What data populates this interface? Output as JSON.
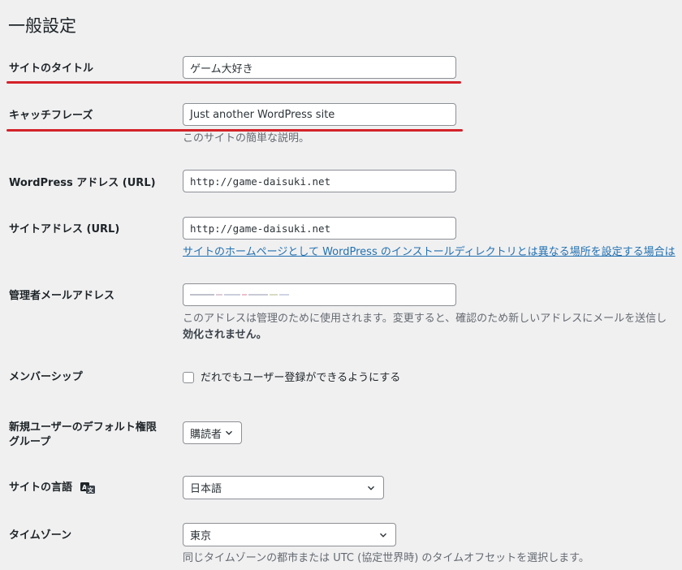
{
  "page": {
    "title": "一般設定"
  },
  "fields": {
    "site_title": {
      "label": "サイトのタイトル",
      "value": "ゲーム大好き"
    },
    "tagline": {
      "label": "キャッチフレーズ",
      "value": "Just another WordPress site",
      "description": "このサイトの簡単な説明。"
    },
    "wp_address": {
      "label": "WordPress アドレス (URL)",
      "value": "http://game-daisuki.net"
    },
    "site_address": {
      "label": "サイトアドレス (URL)",
      "value": "http://game-daisuki.net",
      "help_link": "サイトのホームページとして WordPress のインストールディレクトリとは異なる場所を設定する場合は"
    },
    "admin_email": {
      "label": "管理者メールアドレス",
      "value": "",
      "description_line1": "このアドレスは管理のために使用されます。変更すると、確認のため新しいアドレスにメールを送信し",
      "description_line2": "効化されません。"
    },
    "membership": {
      "label": "メンバーシップ",
      "checkbox_label": "だれでもユーザー登録ができるようにする",
      "checked": false
    },
    "default_role": {
      "label_line1": "新規ユーザーのデフォルト権限",
      "label_line2": "グループ",
      "selected": "購読者"
    },
    "site_language": {
      "label": "サイトの言語",
      "selected": "日本語"
    },
    "timezone": {
      "label": "タイムゾーン",
      "selected": "東京",
      "description": "同じタイムゾーンの都市または UTC (協定世界時) のタイムオフセットを選択します。"
    }
  },
  "annotations": {
    "underline_color": "#d42229"
  },
  "icons": {
    "language": "translate-icon",
    "chevron": "chevron-down-icon"
  }
}
